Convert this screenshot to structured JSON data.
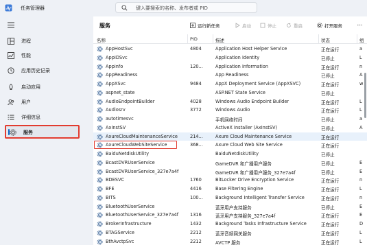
{
  "window": {
    "title": "任务管理器",
    "search_placeholder": "键入要搜索的名称、发布者或 PID"
  },
  "sidebar": {
    "items": [
      {
        "label": "进程",
        "icon": "processes-icon"
      },
      {
        "label": "性能",
        "icon": "performance-icon"
      },
      {
        "label": "应用历史记录",
        "icon": "app-history-icon"
      },
      {
        "label": "启动应用",
        "icon": "startup-icon"
      },
      {
        "label": "用户",
        "icon": "users-icon"
      },
      {
        "label": "详细信息",
        "icon": "details-icon"
      },
      {
        "label": "服务",
        "icon": "services-icon"
      }
    ],
    "selected_index": 6
  },
  "toolbar": {
    "title": "服务",
    "run_new_task": "运行新任务",
    "start": "启动",
    "stop": "停止",
    "restart": "重启",
    "open_services": "打开服务",
    "more": "..."
  },
  "table": {
    "headers": {
      "name": "名称",
      "pid": "PID",
      "description": "描述",
      "status": "状态",
      "group": "组"
    },
    "rows": [
      {
        "name": "AppHostSvc",
        "pid": "4804",
        "description": "Application Host Helper Service",
        "status": "正在运行",
        "group": "a"
      },
      {
        "name": "AppIDSvc",
        "pid": "",
        "description": "Application Identity",
        "status": "已停止",
        "group": "L"
      },
      {
        "name": "Appinfo",
        "pid": "120...",
        "description": "Application Information",
        "status": "正在运行",
        "group": "n"
      },
      {
        "name": "AppReadiness",
        "pid": "",
        "description": "App Readiness",
        "status": "已停止",
        "group": "A"
      },
      {
        "name": "AppXSvc",
        "pid": "9484",
        "description": "AppX Deployment Service (AppXSVC)",
        "status": "正在运行",
        "group": "w"
      },
      {
        "name": "aspnet_state",
        "pid": "",
        "description": "ASP.NET State Service",
        "status": "已停止",
        "group": ""
      },
      {
        "name": "AudioEndpointBuilder",
        "pid": "4028",
        "description": "Windows Audio Endpoint Builder",
        "status": "正在运行",
        "group": "L"
      },
      {
        "name": "Audiosrv",
        "pid": "3772",
        "description": "Windows Audio",
        "status": "正在运行",
        "group": "L"
      },
      {
        "name": "autotimesvc",
        "pid": "",
        "description": "手机网络时间",
        "status": "已停止",
        "group": "a"
      },
      {
        "name": "AxInstSV",
        "pid": "",
        "description": "ActiveX Installer (AxInstSV)",
        "status": "已停止",
        "group": "A"
      },
      {
        "name": "AxureCloudMaintenanceService",
        "pid": "214...",
        "description": "Axure Cloud Maintenance Service",
        "status": "正在运行",
        "group": ""
      },
      {
        "name": "AxureCloudWebSiteService",
        "pid": "368...",
        "description": "Axure Cloud Web Site Service",
        "status": "正在运行",
        "group": ""
      },
      {
        "name": "BaiduNetdiskUtility",
        "pid": "",
        "description": "BaiduNetdiskUtility",
        "status": "已停止",
        "group": ""
      },
      {
        "name": "BcastDVRUserService",
        "pid": "",
        "description": "GameDVR 和广播用户服务",
        "status": "已停止",
        "group": "E"
      },
      {
        "name": "BcastDVRUserService_327e7a4f",
        "pid": "",
        "description": "GameDVR 和广播用户服务_327e7a4f",
        "status": "已停止",
        "group": "E"
      },
      {
        "name": "BDESVC",
        "pid": "1760",
        "description": "BitLocker Drive Encryption Service",
        "status": "正在运行",
        "group": "n"
      },
      {
        "name": "BFE",
        "pid": "4416",
        "description": "Base Filtering Engine",
        "status": "正在运行",
        "group": "L"
      },
      {
        "name": "BITS",
        "pid": "100...",
        "description": "Background Intelligent Transfer Service",
        "status": "正在运行",
        "group": "n"
      },
      {
        "name": "BluetoothUserService",
        "pid": "",
        "description": "蓝牙用户支持服务",
        "status": "已停止",
        "group": "E"
      },
      {
        "name": "BluetoothUserService_327e7a4f",
        "pid": "1316",
        "description": "蓝牙用户支持服务_327e7a4f",
        "status": "正在运行",
        "group": "E"
      },
      {
        "name": "BrokerInfrastructure",
        "pid": "1432",
        "description": "Background Tasks Infrastructure Service",
        "status": "正在运行",
        "group": "D"
      },
      {
        "name": "BTAGService",
        "pid": "2212",
        "description": "蓝牙音频网关服务",
        "status": "正在运行",
        "group": "L"
      },
      {
        "name": "BthAvctpSvc",
        "pid": "2212",
        "description": "AVCTP 服务",
        "status": "正在运行",
        "group": "L"
      }
    ],
    "selected_row_index": 10,
    "highlighted_row_index": 11
  },
  "colors": {
    "highlight_border": "#e23b2f",
    "accent": "#0a64c8",
    "selected_row": "#e8f1fb",
    "sidebar_bg": "#eef1f6"
  }
}
